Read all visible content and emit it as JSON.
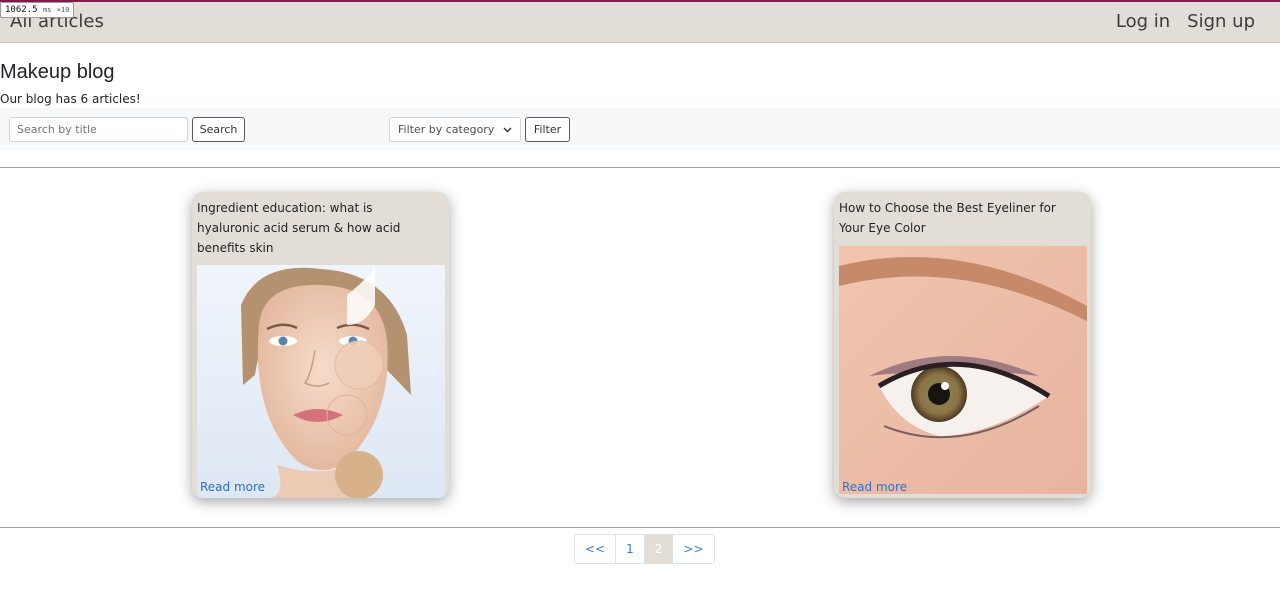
{
  "perf": {
    "value": "1062.5",
    "unit": "ms",
    "mult": "×10"
  },
  "navbar": {
    "brand": "All articles",
    "login": "Log in",
    "signup": "Sign up"
  },
  "page": {
    "title": "Makeup blog",
    "count_text": "Our blog has 6 articles!"
  },
  "filters": {
    "search_placeholder": "Search by title",
    "search_button": "Search",
    "category_selected": "Filter by category",
    "filter_button": "Filter"
  },
  "articles": [
    {
      "title": "Ingredient education: what is hyaluronic acid serum & how acid benefits skin",
      "read_more": "Read more"
    },
    {
      "title": "How to Choose the Best Eyeliner for Your Eye Color",
      "read_more": "Read more"
    }
  ],
  "pagination": {
    "prev": "<<",
    "pages": [
      "1",
      "2"
    ],
    "current": "2",
    "next": ">>"
  },
  "colors": {
    "navbar_bg": "#e3ddd7",
    "top_accent": "#7d1d4f",
    "link": "#2a6fd1"
  },
  "icons": {
    "select_arrow": "chevron-down-icon"
  }
}
